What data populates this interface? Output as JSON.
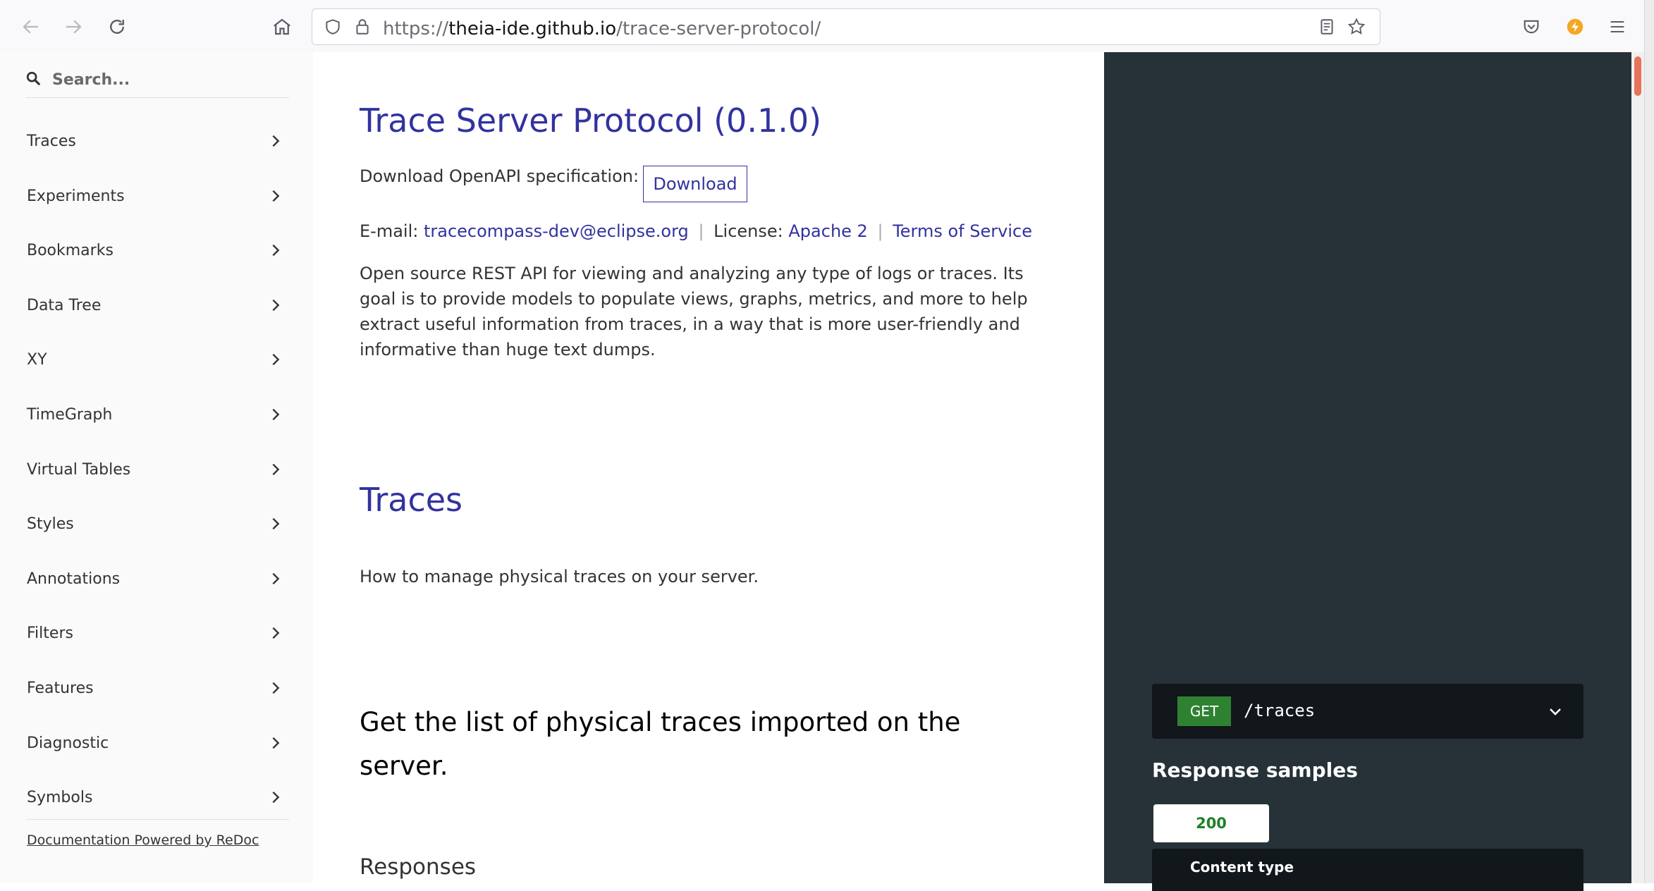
{
  "browser": {
    "url_scheme": "https://",
    "url_host": "theia-ide.github.io",
    "url_path": "/trace-server-protocol/"
  },
  "sidebar": {
    "search_placeholder": "Search...",
    "items": [
      {
        "label": "Traces"
      },
      {
        "label": "Experiments"
      },
      {
        "label": "Bookmarks"
      },
      {
        "label": "Data Tree"
      },
      {
        "label": "XY"
      },
      {
        "label": "TimeGraph"
      },
      {
        "label": "Virtual Tables"
      },
      {
        "label": "Styles"
      },
      {
        "label": "Annotations"
      },
      {
        "label": "Filters"
      },
      {
        "label": "Features"
      },
      {
        "label": "Diagnostic"
      },
      {
        "label": "Symbols"
      }
    ],
    "powered_by": "Documentation Powered by ReDoc"
  },
  "main": {
    "title": "Trace Server Protocol (0.1.0)",
    "download_label": "Download OpenAPI specification:",
    "download_button": "Download",
    "email_label": "E-mail:",
    "email": "tracecompass-dev@eclipse.org",
    "separator": "|",
    "license_label": "License:",
    "license": "Apache 2",
    "terms": "Terms of Service",
    "description": "Open source REST API for viewing and analyzing any type of logs or traces. Its goal is to provide models to populate views, graphs, metrics, and more to help extract useful information from traces, in a way that is more user-friendly and informative than huge text dumps.",
    "section_title": "Traces",
    "section_desc": "How to manage physical traces on your server.",
    "operation_title": "Get the list of physical traces imported on the server.",
    "responses_heading": "Responses"
  },
  "right_panel": {
    "method": "GET",
    "path": "/traces",
    "response_samples": "Response samples",
    "status_code": "200",
    "content_type_label": "Content type"
  },
  "colors": {
    "link": "#32329f",
    "dark_panel": "#263238",
    "get_badge": "#2f8132"
  }
}
